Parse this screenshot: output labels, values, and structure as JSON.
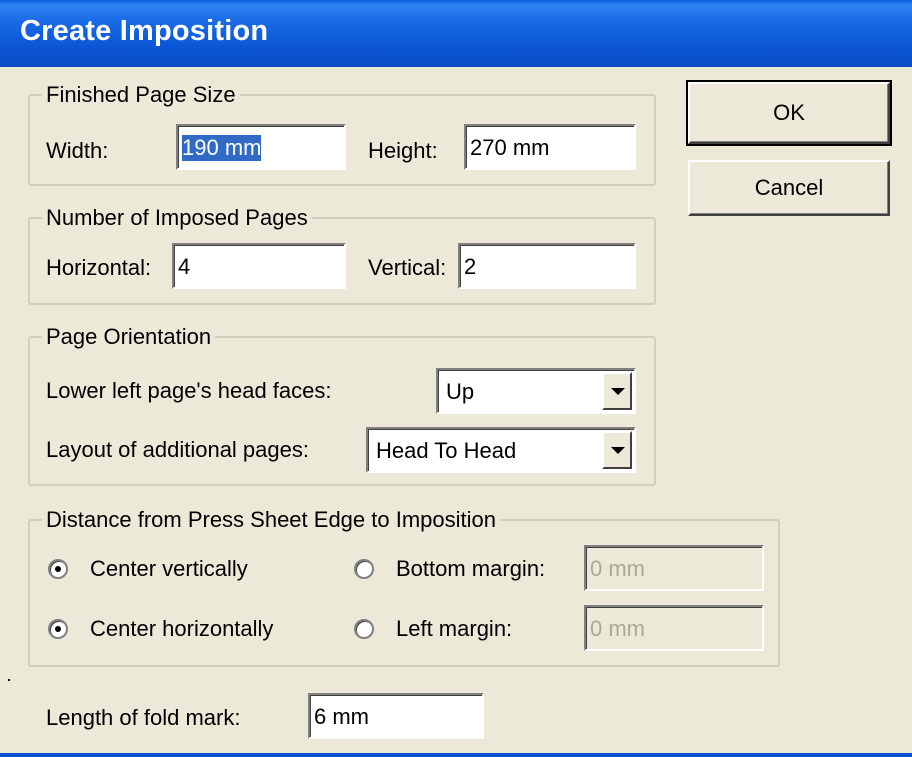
{
  "window": {
    "title": "Create Imposition"
  },
  "buttons": {
    "ok": "OK",
    "cancel": "Cancel"
  },
  "finished_page_size": {
    "label": "Finished Page Size",
    "width_label": "Width:",
    "width_value": "190 mm",
    "height_label": "Height:",
    "height_value": "270 mm"
  },
  "imposed_pages": {
    "label": "Number of Imposed Pages",
    "horizontal_label": "Horizontal:",
    "horizontal_value": "4",
    "vertical_label": "Vertical:",
    "vertical_value": "2"
  },
  "orientation": {
    "label": "Page Orientation",
    "head_faces_label": "Lower left page's head faces:",
    "head_faces_value": "Up",
    "layout_label": "Layout of additional pages:",
    "layout_value": "Head To Head"
  },
  "distance": {
    "label": "Distance from Press Sheet Edge to Imposition",
    "center_vertically": "Center vertically",
    "center_horizontally": "Center horizontally",
    "bottom_margin_label": "Bottom margin:",
    "bottom_margin_value": "0 mm",
    "left_margin_label": "Left margin:",
    "left_margin_value": "0 mm"
  },
  "fold_mark": {
    "label": "Length of fold mark:",
    "value": "6 mm"
  },
  "colors": {
    "title_bar": "#0a58d8",
    "dialog_bg": "#ece9d8",
    "selection": "#316ac5"
  }
}
